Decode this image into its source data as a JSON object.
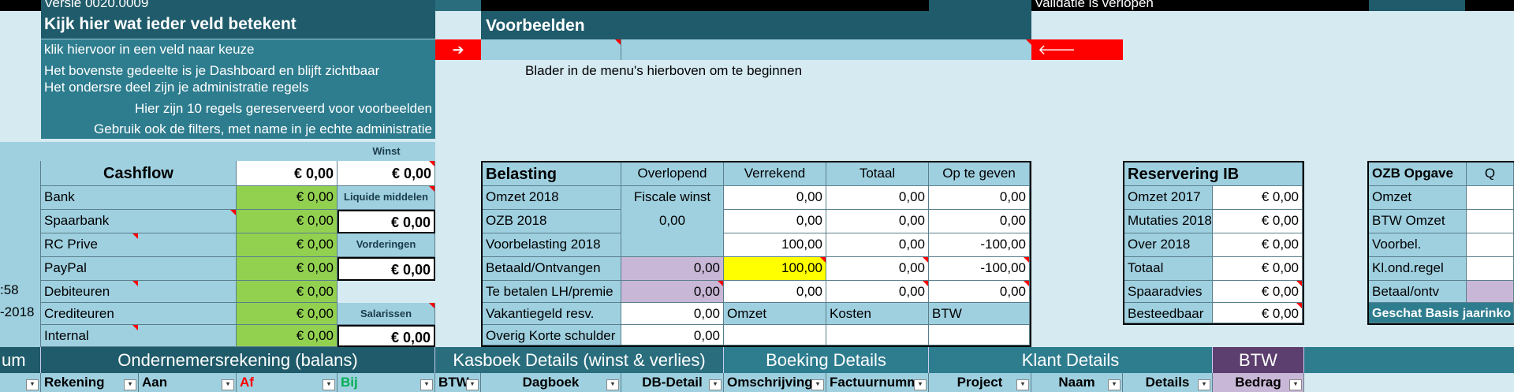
{
  "top": {
    "version": "Versie 0020.0009",
    "validation": "Validatie is verlopen"
  },
  "help": {
    "title": "Kijk hier wat ieder veld betekent",
    "lines": [
      "klik hiervoor in een veld naar keuze",
      "Het bovenste gedeelte is je Dashboard en blijft zichtbaar",
      "Het ondersre deel zijn je administratie regels",
      "Hier zijn 10 regels gereserveerd voor voorbeelden",
      "Gebruik ook de filters, met name in je echte administratie"
    ]
  },
  "examples": {
    "title": "Voorbeelden",
    "hint": "Blader in de menu's hierboven om te beginnen",
    "arrow_right": "➔",
    "arrow_left": "🡐"
  },
  "left_fragments": {
    "time": ":58",
    "date": "-2018",
    "um": "um"
  },
  "cashflow": {
    "winst_label": "Winst",
    "title": "Cashflow",
    "total": "€ 0,00",
    "winst_value": "€ 0,00",
    "rows": [
      {
        "label": "Bank",
        "value": "€ 0,00"
      },
      {
        "label": "Spaarbank",
        "value": "€ 0,00"
      },
      {
        "label": "RC Prive",
        "value": "€ 0,00"
      },
      {
        "label": "PayPal",
        "value": "€ 0,00"
      },
      {
        "label": "Debiteuren",
        "value": "€ 0,00"
      },
      {
        "label": "Crediteuren",
        "value": "€ 0,00"
      },
      {
        "label": "Internal",
        "value": "€ 0,00"
      }
    ],
    "side": {
      "liquide_label": "Liquide middelen",
      "liquide_value": "€ 0,00",
      "vorderingen_label": "Vorderingen",
      "vorderingen_value": "€ 0,00",
      "salarissen_label": "Salarissen",
      "salarissen_value": "€ 0,00"
    }
  },
  "belasting": {
    "title": "Belasting",
    "headers": [
      "Overlopend",
      "Verrekend",
      "Totaal",
      "Op te geven"
    ],
    "rows": [
      {
        "label": "Omzet 2018",
        "c1": "Fiscale winst",
        "c2": "0,00",
        "c3": "0,00",
        "c4": "0,00"
      },
      {
        "label": "OZB 2018",
        "c1": "0,00",
        "c2": "0,00",
        "c3": "0,00",
        "c4": "0,00"
      },
      {
        "label": "Voorbelasting 2018",
        "c1": "",
        "c2": "100,00",
        "c3": "0,00",
        "c4": "-100,00"
      },
      {
        "label": "Betaald/Ontvangen",
        "c1": "0,00",
        "c2": "100,00",
        "c3": "0,00",
        "c4": "-100,00"
      },
      {
        "label": "Te betalen LH/premie",
        "c1": "0,00",
        "c2": "0,00",
        "c3": "0,00",
        "c4": "0,00"
      },
      {
        "label": "Vakantiegeld resv.",
        "c1": "0,00",
        "c2": "Omzet",
        "c3": "Kosten",
        "c4": "BTW"
      },
      {
        "label": "Overig Korte schulder",
        "c1": "0,00",
        "c2": "",
        "c3": "",
        "c4": ""
      }
    ]
  },
  "reservering": {
    "title": "Reservering IB",
    "rows": [
      {
        "label": "Omzet 2017",
        "value": "€ 0,00"
      },
      {
        "label": "Mutaties 2018",
        "value": "€ 0,00"
      },
      {
        "label": "Over 2018",
        "value": "€ 0,00"
      },
      {
        "label": "Totaal",
        "value": "€ 0,00"
      },
      {
        "label": "Spaaradvies",
        "value": "€ 0,00"
      },
      {
        "label": "Besteedbaar",
        "value": "€ 0,00"
      }
    ]
  },
  "ozb": {
    "title": "OZB Opgave",
    "col2": "Q",
    "rows": [
      "Omzet",
      "BTW Omzet",
      "Voorbel.",
      "Kl.ond.regel",
      "Betaal/ontv"
    ],
    "footer": "Geschat Basis jaarinko"
  },
  "sections": {
    "ondernemer": "Ondernemersrekening (balans)",
    "kasboek": "Kasboek Details (winst & verlies)",
    "boeking": "Boeking Details",
    "klant": "Klant Details",
    "btw": "BTW"
  },
  "columns": {
    "rekening": "Rekening",
    "aan": "Aan",
    "af": "Af",
    "bij": "Bij",
    "btw": "BTW",
    "dagboek": "Dagboek",
    "dbdetail": "DB-Detail",
    "omschrijving": "Omschrijving",
    "factuur": "Factuurnumm",
    "project": "Project",
    "naam": "Naam",
    "details": "Details",
    "bedrag": "Bedrag"
  },
  "colors": {
    "dark_teal": "#1f5b6a",
    "teal": "#2e7d8f",
    "light_blue": "#9fd0e0",
    "green": "#92d050",
    "purple": "#5c3f6e",
    "lilac": "#c9b7d7",
    "red": "#ff0000",
    "yellow": "#ffff00",
    "af_red": "#ff0000",
    "bij_green": "#00b050"
  }
}
